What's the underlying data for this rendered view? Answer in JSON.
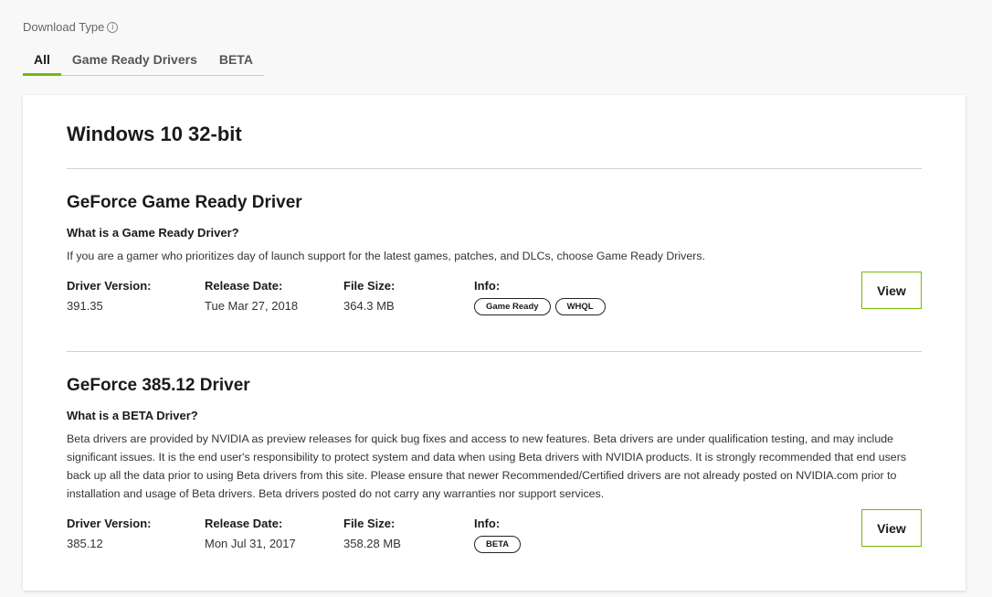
{
  "download_type": {
    "label": "Download Type",
    "info_icon": "i"
  },
  "tabs": [
    {
      "label": "All",
      "active": true
    },
    {
      "label": "Game Ready Drivers",
      "active": false
    },
    {
      "label": "BETA",
      "active": false
    }
  ],
  "colors": {
    "accent": "#76b900"
  },
  "card": {
    "os_title": "Windows 10 32-bit",
    "drivers": [
      {
        "title": "GeForce Game Ready Driver",
        "question": "What is a Game Ready Driver?",
        "description": "If you are a gamer who prioritizes day of launch support for the latest games, patches, and DLCs, choose Game Ready Drivers.",
        "version_label": "Driver Version:",
        "version": "391.35",
        "date_label": "Release Date:",
        "date": "Tue Mar 27, 2018",
        "size_label": "File Size:",
        "size": "364.3 MB",
        "info_label": "Info:",
        "badges": [
          "Game Ready",
          "WHQL"
        ],
        "view_label": "View"
      },
      {
        "title": "GeForce 385.12 Driver",
        "question": "What is a BETA Driver?",
        "description": "Beta drivers are provided by NVIDIA as preview releases for quick bug fixes and access to new features. Beta drivers are under qualification testing, and may include significant issues. It is the end user's responsibility to protect system and data when using Beta drivers with NVIDIA products. It is strongly recommended that end users back up all the data prior to using Beta drivers from this site. Please ensure that newer Recommended/Certified drivers are not already posted on NVIDIA.com prior to installation and usage of Beta drivers. Beta drivers posted do not carry any warranties nor support services.",
        "version_label": "Driver Version:",
        "version": "385.12",
        "date_label": "Release Date:",
        "date": "Mon Jul 31, 2017",
        "size_label": "File Size:",
        "size": "358.28 MB",
        "info_label": "Info:",
        "badges": [
          "BETA"
        ],
        "view_label": "View"
      }
    ]
  }
}
